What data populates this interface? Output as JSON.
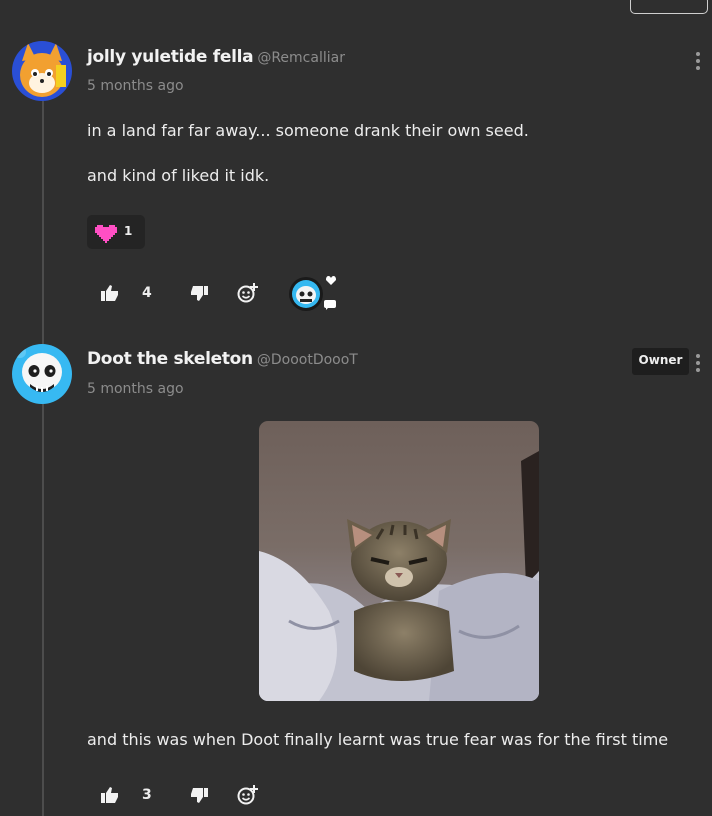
{
  "header": {
    "icon": "outline-button"
  },
  "comments": [
    {
      "author": "jolly yuletide fella",
      "handle": "@Remcalliar",
      "time": "5 months ago",
      "lines": [
        "in a land far far away... someone drank their own seed.",
        "and kind of liked it idk."
      ],
      "reaction": {
        "emoji": "pink-pixel-heart-icon",
        "count": "1"
      },
      "likes": "4",
      "menu_icon": "more-vertical-icon"
    },
    {
      "author": "Doot the skeleton",
      "handle": "@DoootDoooT",
      "time": "5 months ago",
      "badge": "Owner",
      "image": "kitten-photo",
      "lines": [
        "and this was when Doot finally learnt was true fear was for the first time"
      ],
      "likes": "3",
      "menu_icon": "more-vertical-icon"
    }
  ],
  "colors": {
    "background": "#2f2f2f",
    "text": "#ececec",
    "muted": "#8c8c8c",
    "heart": "#ff4fc4"
  }
}
